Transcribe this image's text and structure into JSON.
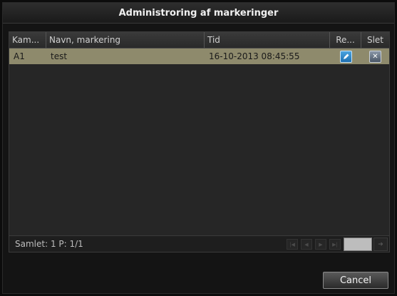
{
  "dialog": {
    "title": "Administroring af markeringer",
    "cancel_label": "Cancel"
  },
  "table": {
    "columns": [
      "Kam...",
      "Navn, markering",
      "Tid",
      "Re...",
      "Slet"
    ],
    "rows": [
      {
        "camera": "A1",
        "name": "test",
        "time": "16-10-2013 08:45:55",
        "edit_icon": "pencil-icon",
        "delete_icon": "close-icon"
      }
    ],
    "selected_row_color": "#8e8a6c"
  },
  "footer": {
    "summary": "Samlet: 1 P: 1/1",
    "pager_icons": [
      "first-page-icon",
      "prev-page-icon",
      "next-page-icon",
      "last-page-icon"
    ],
    "page_input_value": "",
    "go_icon": "go-icon"
  }
}
